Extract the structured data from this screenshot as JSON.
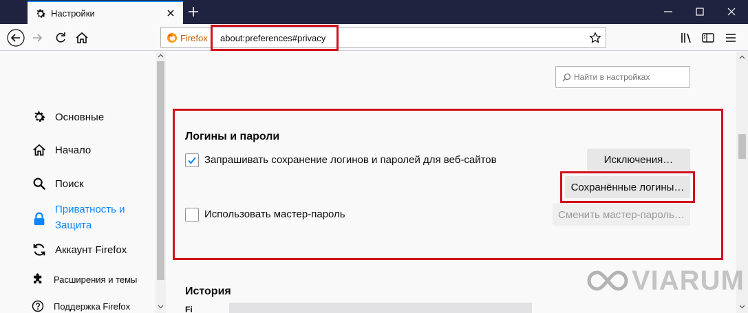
{
  "window": {
    "tab_title": "Настройки"
  },
  "navbar": {
    "identity_label": "Firefox",
    "url": "about:preferences#privacy"
  },
  "sidebar": {
    "items": [
      {
        "label": "Основные",
        "icon": "gear-icon"
      },
      {
        "label": "Начало",
        "icon": "home-icon"
      },
      {
        "label": "Поиск",
        "icon": "search-icon"
      },
      {
        "label": "Приватность и Защита",
        "line1": "Приватность и",
        "line2": "Защита",
        "icon": "lock-icon",
        "active": true
      },
      {
        "label": "Аккаунт Firefox",
        "icon": "sync-icon"
      },
      {
        "label": "Расширения и темы",
        "icon": "puzzle-icon"
      },
      {
        "label": "Поддержка Firefox",
        "icon": "help-icon"
      }
    ]
  },
  "search": {
    "placeholder": "Найти в настройках"
  },
  "logins": {
    "title": "Логины и пароли",
    "ask_to_save_label": "Запрашивать сохранение логинов и паролей для веб-сайтов",
    "ask_to_save_checked": true,
    "exceptions_button": "Исключения…",
    "saved_logins_button": "Сохранённые логины…",
    "master_password_label": "Использовать мастер-пароль",
    "master_password_checked": false,
    "change_master_button": "Сменить мастер-пароль…"
  },
  "history": {
    "title": "История",
    "cut_label": "Fi"
  },
  "watermark": {
    "text": "VIARUM"
  },
  "colors": {
    "accent": "#0a84ff",
    "highlight": "#d20f1e",
    "titlebar": "#202340"
  }
}
